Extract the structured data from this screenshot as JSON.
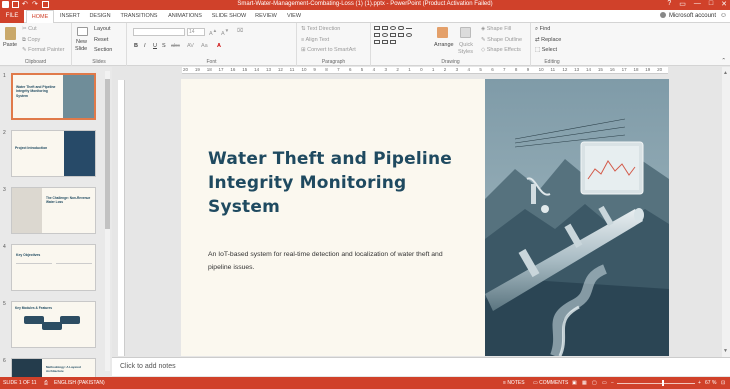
{
  "window": {
    "title": "Smart-Water-Management-Combating-Loss (1) (1).pptx - PowerPoint (Product Activation Failed)",
    "controls": [
      "?",
      "▭",
      "—",
      "□",
      "✕"
    ]
  },
  "tabs": {
    "file": "FILE",
    "items": [
      "HOME",
      "INSERT",
      "DESIGN",
      "TRANSITIONS",
      "ANIMATIONS",
      "SLIDE SHOW",
      "REVIEW",
      "VIEW"
    ],
    "active": "HOME",
    "account": "Microsoft account"
  },
  "ribbon": {
    "clipboard": {
      "paste": "Paste",
      "cut": "Cut",
      "copy": "Copy",
      "format_painter": "Format Painter",
      "label": "Clipboard"
    },
    "slides": {
      "new_slide": "New",
      "new_slide2": "Slide",
      "layout": "Layout",
      "reset": "Reset",
      "section": "Section",
      "label": "Slides"
    },
    "font": {
      "font_name": "",
      "font_size": "14",
      "bold": "B",
      "italic": "I",
      "underline": "U",
      "strike": "S",
      "shadow": "abc",
      "spacing": "AV",
      "case": "Aa",
      "color": "A",
      "label": "Font"
    },
    "paragraph": {
      "text_direction": "Text Direction",
      "align_text": "Align Text",
      "convert_smartart": "Convert to SmartArt",
      "label": "Paragraph"
    },
    "drawing": {
      "arrange": "Arrange",
      "quick_styles": "Quick",
      "quick_styles2": "Styles",
      "shape_fill": "Shape Fill",
      "shape_outline": "Shape Outline",
      "shape_effects": "Shape Effects",
      "label": "Drawing"
    },
    "editing": {
      "find": "Find",
      "replace": "Replace",
      "select": "Select",
      "label": "Editing"
    }
  },
  "thumbnails": [
    {
      "num": "1",
      "title": "Water Theft and Pipeline Integrity Monitoring System"
    },
    {
      "num": "2",
      "title": "Project Introduction"
    },
    {
      "num": "3",
      "title": "The Challenge: Non-Revenue Water Loss"
    },
    {
      "num": "4",
      "title": "Key Objectives"
    },
    {
      "num": "5",
      "title": "Key Modules & Features"
    },
    {
      "num": "6",
      "title": "Methodology: A Layered Architecture"
    }
  ],
  "ruler": {
    "marks": [
      "20",
      "19",
      "18",
      "17",
      "16",
      "15",
      "14",
      "13",
      "12",
      "11",
      "10",
      "9",
      "8",
      "7",
      "6",
      "5",
      "4",
      "3",
      "2",
      "1",
      "0",
      "1",
      "2",
      "3",
      "4",
      "5",
      "6",
      "7",
      "8",
      "9",
      "10",
      "11",
      "12",
      "13",
      "14",
      "15",
      "16",
      "17",
      "18",
      "19",
      "20"
    ]
  },
  "slide": {
    "title": "Water Theft and Pipeline Integrity Monitoring System",
    "subtitle": "An IoT-based system for real-time detection and localization of water theft and pipeline issues."
  },
  "notes": {
    "placeholder": "Click to add notes"
  },
  "status": {
    "slide_info": "SLIDE 1 OF 11",
    "language": "ENGLISH (PAKISTAN)",
    "notes": "NOTES",
    "comments": "COMMENTS",
    "zoom": "67 %"
  },
  "colors": {
    "accent": "#d0412a",
    "title_text": "#1f4a60",
    "slide_bg": "#fbf8ef",
    "art_sky": "#8faab5",
    "art_dark": "#2b4a5a"
  }
}
